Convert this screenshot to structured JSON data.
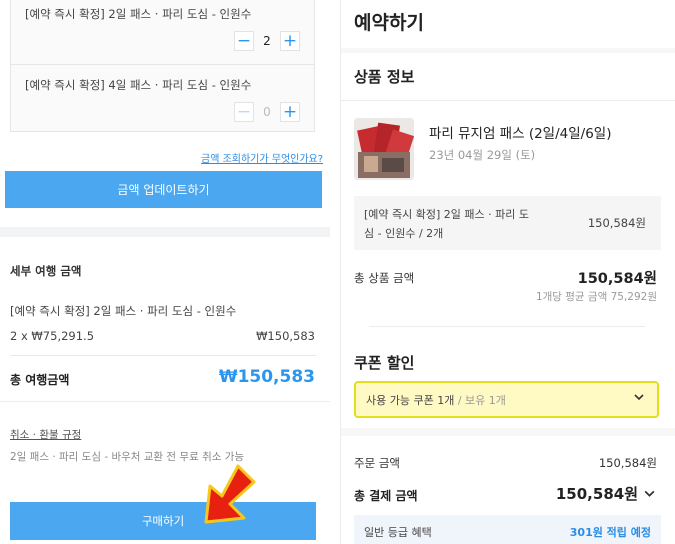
{
  "options": [
    {
      "label": "[예약 즉시 확정] 2일 패스 · 파리 도심 - 인원수",
      "quantity": "2"
    },
    {
      "label": "[예약 즉시 확정] 4일 패스 · 파리 도심 - 인원수",
      "quantity": "0"
    }
  ],
  "stepper": {
    "minus": "−",
    "plus": "+"
  },
  "price_help_link": "금액 조회하기가 무엇인가요?",
  "update_button": "금액 업데이트하기",
  "detail": {
    "title": "세부 여행 금액",
    "item": "[예약 즉시 확정] 2일 패스 · 파리 도심 - 인원수",
    "qty_price": "2 x ₩75,291.5",
    "subtotal": "₩150,583",
    "total_label": "총 여행금액",
    "total_value": "₩150,583"
  },
  "refund": {
    "link": "취소 · 환불 규정",
    "desc": "2일 패스 · 파리 도심 - 바우처 교환 전 무료 취소 가능"
  },
  "buy_button": "구매하기",
  "booking": {
    "title": "예약하기",
    "product_info_title": "상품 정보",
    "product_name": "파리 뮤지엄 패스 (2일/4일/6일)",
    "product_date": "23년 04월 29일 (토)",
    "line_desc": "[예약 즉시 확정] 2일 패스 · 파리 도심 - 인원수 / 2개",
    "line_price": "150,584원",
    "sum_label": "총 상품 금액",
    "sum_value": "150,584원",
    "sum_avg": "1개당 평균 금액 75,292원",
    "coupon_title": "쿠폰 할인",
    "coupon_main": "사용 가능 쿠폰 1개",
    "coupon_sub": " / 보유 1개",
    "order_label": "주문 금액",
    "order_value": "150,584원",
    "pay_label": "총 결제 금액",
    "pay_value": "150,584원",
    "benefit_label": "일반 등급 혜택",
    "benefit_value": "301원 적립 예정"
  },
  "colors": {
    "accent": "#4aa7f0",
    "price_blue": "#2b96ed",
    "coupon_bg": "#fff9c4",
    "coupon_border": "#e3df1a",
    "arrow_red": "#e8200f",
    "arrow_yellow": "#f7c81c"
  }
}
